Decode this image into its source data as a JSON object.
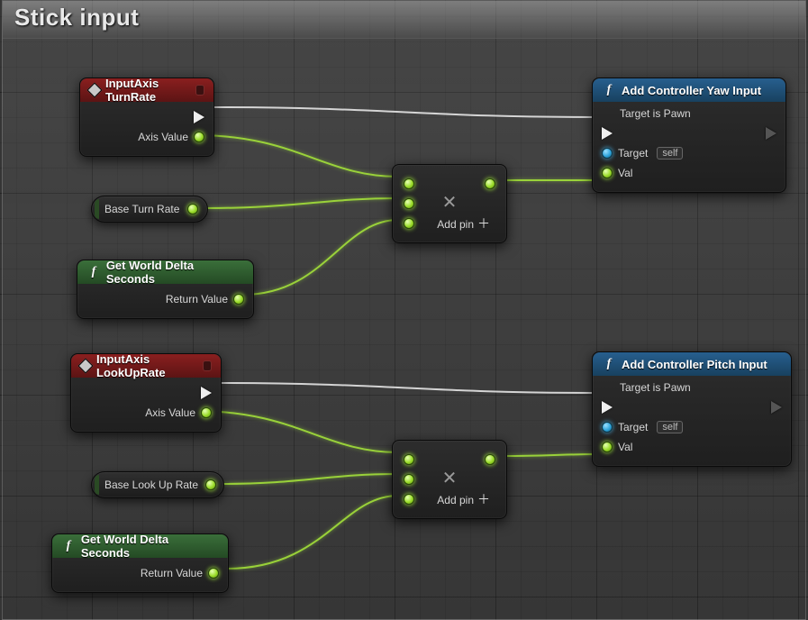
{
  "group": {
    "title": "Stick input"
  },
  "nodes": {
    "turnRate": {
      "title": "InputAxis TurnRate",
      "axisLabel": "Axis Value"
    },
    "lookUpRate": {
      "title": "InputAxis LookUpRate",
      "axisLabel": "Axis Value"
    },
    "yawInput": {
      "title": "Add Controller Yaw Input",
      "subtitle": "Target is Pawn",
      "targetLabel": "Target",
      "selfLabel": "self",
      "valLabel": "Val"
    },
    "pitchInput": {
      "title": "Add Controller Pitch Input",
      "subtitle": "Target is Pawn",
      "targetLabel": "Target",
      "selfLabel": "self",
      "valLabel": "Val"
    },
    "baseTurn": {
      "label": "Base Turn Rate"
    },
    "baseLookUp": {
      "label": "Base Look Up Rate"
    },
    "delta1": {
      "title": "Get World Delta Seconds",
      "returnLabel": "Return Value"
    },
    "delta2": {
      "title": "Get World Delta Seconds",
      "returnLabel": "Return Value"
    },
    "mul": {
      "addPinLabel": "Add pin"
    }
  }
}
